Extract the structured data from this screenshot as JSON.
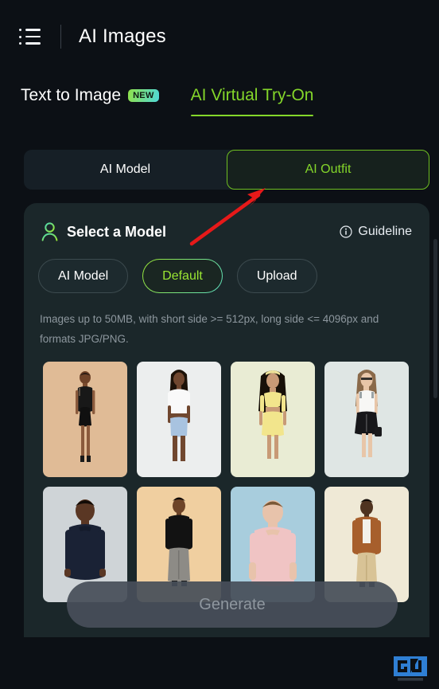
{
  "header": {
    "menu_icon": "list-menu-icon",
    "title": "AI Images"
  },
  "top_tabs": [
    {
      "label": "Text to Image",
      "badge": "NEW",
      "active": false
    },
    {
      "label": "AI Virtual Try-On",
      "badge": null,
      "active": true
    }
  ],
  "segment": {
    "options": [
      {
        "label": "AI Model",
        "active": false
      },
      {
        "label": "AI Outfit",
        "active": true
      }
    ]
  },
  "card": {
    "icon": "person-icon",
    "title": "Select a Model",
    "guideline": {
      "icon": "info-circle-icon",
      "label": "Guideline"
    },
    "pills": [
      {
        "label": "AI Model",
        "active": false
      },
      {
        "label": "Default",
        "active": true
      },
      {
        "label": "Upload",
        "active": false
      }
    ],
    "hint": "Images up to 50MB, with short side >= 512px, long side <= 4096px and formats JPG/PNG.",
    "thumbnails": [
      {
        "name": "model-black-dress",
        "bg": "#e0bb96",
        "skin": "#8a5a3c",
        "outfit": "#151515",
        "hair": "#2a1a12"
      },
      {
        "name": "model-white-crop-top",
        "bg": "#eceeee",
        "skin": "#6b4630",
        "outfit": "#f7f7f7",
        "hair": "#1d1208"
      },
      {
        "name": "model-yellow-set",
        "bg": "#e9ecd4",
        "skin": "#c89a76",
        "outfit": "#f2e58c",
        "hair": "#171008"
      },
      {
        "name": "model-white-top-skirt",
        "bg": "#dfe6e4",
        "skin": "#e3bda0",
        "outfit": "#f4f4f2",
        "hair": "#8a6a4a"
      },
      {
        "name": "model-navy-sweater",
        "bg": "#cfd4d7",
        "skin": "#5a3724",
        "outfit": "#1a2235",
        "hair": "#120b06"
      },
      {
        "name": "model-black-sweater",
        "bg": "#f0cfa0",
        "skin": "#6d4428",
        "outfit": "#121212",
        "hair": "#0e0805"
      },
      {
        "name": "model-pink-tshirt",
        "bg": "#a8cddd",
        "skin": "#e8c3ab",
        "outfit": "#f0c4c4",
        "hair": "#7a5836"
      },
      {
        "name": "model-brown-jacket",
        "bg": "#efe9d6",
        "skin": "#4f3320",
        "outfit": "#a75f2c",
        "hair": "#100a05"
      }
    ]
  },
  "generate": {
    "label": "Generate"
  },
  "annotation": {
    "arrow_color": "#e61919",
    "arrow_name": "red-pointer-arrow"
  },
  "watermark": {
    "text": "GU",
    "color": "#2f7fd4"
  },
  "colors": {
    "accent_green": "#84d62a",
    "accent_cyan": "#4fd9d9",
    "page_bg": "#0c1015",
    "card_bg": "#1b272a",
    "segment_bg": "#161f26"
  }
}
